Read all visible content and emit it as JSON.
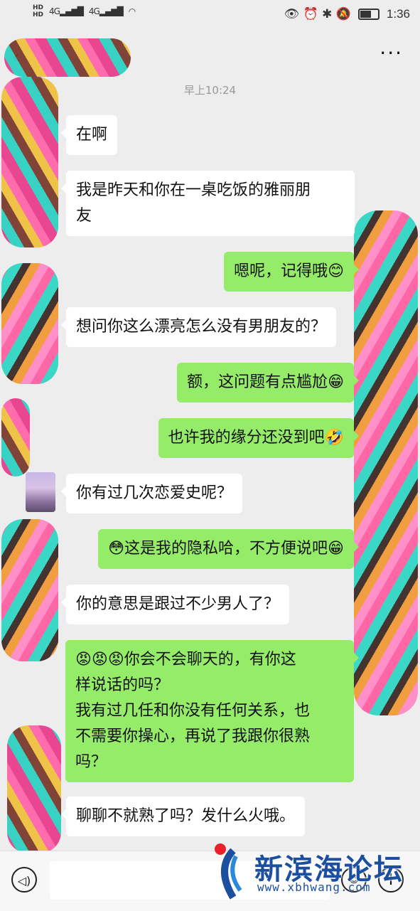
{
  "status_bar": {
    "left_hd_1": "HD",
    "left_hd_2": "HD",
    "signal_1": "4G▂▄▆█",
    "signal_2": "4G▂▄▆█",
    "wifi": "◠",
    "right_icons": "👁 ⏰ ✱ 🔕",
    "time": "1:36",
    "battery_level": 0.75
  },
  "title_bar": {
    "back": "‹",
    "more": "···"
  },
  "timestamp": "早上10:24",
  "messages": [
    {
      "side": "recv",
      "text": "在啊"
    },
    {
      "side": "recv",
      "text": "我是昨天和你在一桌吃饭的雅丽朋\n友"
    },
    {
      "side": "sent",
      "text": "嗯呢，记得哦😊"
    },
    {
      "side": "recv",
      "text": "想问你这么漂亮怎么没有男朋友的？"
    },
    {
      "side": "sent",
      "text": "额，这问题有点尴尬😁"
    },
    {
      "side": "sent",
      "text": "也许我的缘分还没到吧🤣"
    },
    {
      "side": "recv",
      "text": "你有过几次恋爱史呢？"
    },
    {
      "side": "sent",
      "text": "😳这是我的隐私哈，不方便说吧😁"
    },
    {
      "side": "recv",
      "text": "你的意思是跟过不少男人了？"
    },
    {
      "side": "sent",
      "text": "😡😡😡你会不会聊天的，有你这\n样说话的吗？\n我有过几任和你没有任何关系，也\n不需要你操心，再说了我跟你很熟\n吗？"
    },
    {
      "side": "recv",
      "text": "聊聊不就熟了吗？发什么火哦。"
    }
  ],
  "input_bar": {
    "voice_icon": "◁)",
    "emoji_icon": "☺",
    "plus_icon": "+",
    "input_value": ""
  },
  "watermark": {
    "name": "新滨海论坛",
    "url": "www.xbhwang.com"
  },
  "colors": {
    "sent_bubble": "#95ec69",
    "recv_bubble": "#ffffff",
    "background": "#ededed",
    "watermark": "#1c4fa0"
  }
}
